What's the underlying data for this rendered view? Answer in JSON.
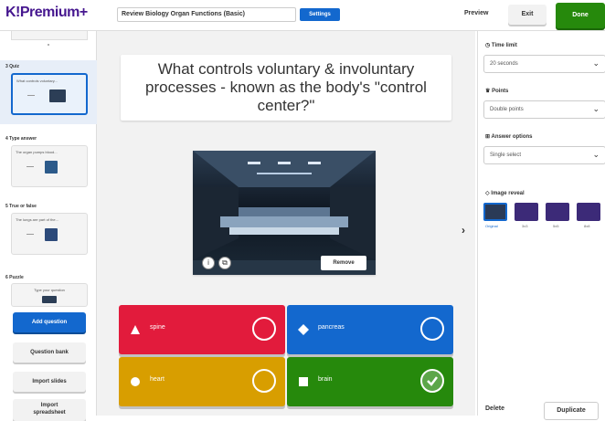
{
  "header": {
    "brand": "K!Premium+",
    "kahoot_title": "Review Biology Organ Functions (Basic)",
    "settings_label": "Settings",
    "preview_label": "Preview",
    "exit_label": "Exit",
    "done_label": "Done"
  },
  "sidebar": {
    "slides": [
      {
        "label": "3  Quiz",
        "thumb_text": "What controls voluntary..."
      },
      {
        "label": "4  Type answer",
        "thumb_text": "The organ pumps blood..."
      },
      {
        "label": "5  True or false",
        "thumb_text": "The lungs are part of the..."
      },
      {
        "label": "6  Puzzle",
        "thumb_text": "Type your question"
      }
    ],
    "add_question": "Add question",
    "question_bank": "Question bank",
    "import_slides": "Import slides",
    "import_spreadsheet_1": "Import",
    "import_spreadsheet_2": "spreadsheet"
  },
  "question": {
    "text": "What controls voluntary & involuntary processes - known as the body's \"control center?\"",
    "remove_label": "Remove",
    "answers": [
      {
        "text": "spine",
        "color": "#e21b3c",
        "shape": "triangle",
        "correct": false
      },
      {
        "text": "pancreas",
        "color": "#1368ce",
        "shape": "diamond",
        "correct": false
      },
      {
        "text": "heart",
        "color": "#d89e00",
        "shape": "circle",
        "correct": false
      },
      {
        "text": "brain",
        "color": "#26890c",
        "shape": "square",
        "correct": true
      }
    ]
  },
  "panel": {
    "time_limit_label": "Time limit",
    "time_limit_value": "20 seconds",
    "points_label": "Points",
    "points_value": "Double points",
    "answer_options_label": "Answer options",
    "answer_options_value": "Single select",
    "image_reveal_label": "Image reveal",
    "reveal_options": [
      "Original",
      "3x3",
      "5x5",
      "8x8"
    ],
    "delete_label": "Delete",
    "duplicate_label": "Duplicate"
  },
  "colors": {
    "brand": "#46178f",
    "accent_blue": "#1368ce",
    "done_green": "#26890c"
  }
}
